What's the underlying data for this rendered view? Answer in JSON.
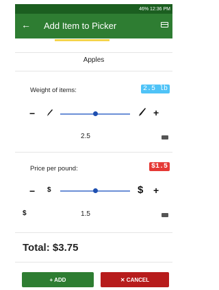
{
  "status_bar": {
    "text": "46% 12:36 PM"
  },
  "app_bar": {
    "back_icon": "arrow-left-icon",
    "title": "Add Item to Picker",
    "menu_icon": "window-icon"
  },
  "item": {
    "name": "Apples"
  },
  "weight": {
    "label": "Weight of items:",
    "chip": "2.5 lb",
    "value": "2.5",
    "slider_fraction": 0.5,
    "minus": "−",
    "plus": "+"
  },
  "price": {
    "label": "Price per pound:",
    "chip": "$1.5",
    "value": "1.5",
    "slider_fraction": 0.5,
    "minus": "−",
    "plus": "+",
    "small_symbol": "$",
    "large_symbol": "$",
    "prefix": "$"
  },
  "total": {
    "text": "Total: $3.75"
  },
  "buttons": {
    "add": "+ ADD",
    "cancel": "✕ CANCEL"
  },
  "colors": {
    "primary": "#2e7d32",
    "danger": "#b71c1c",
    "accent_blue": "#4fc3f7"
  }
}
